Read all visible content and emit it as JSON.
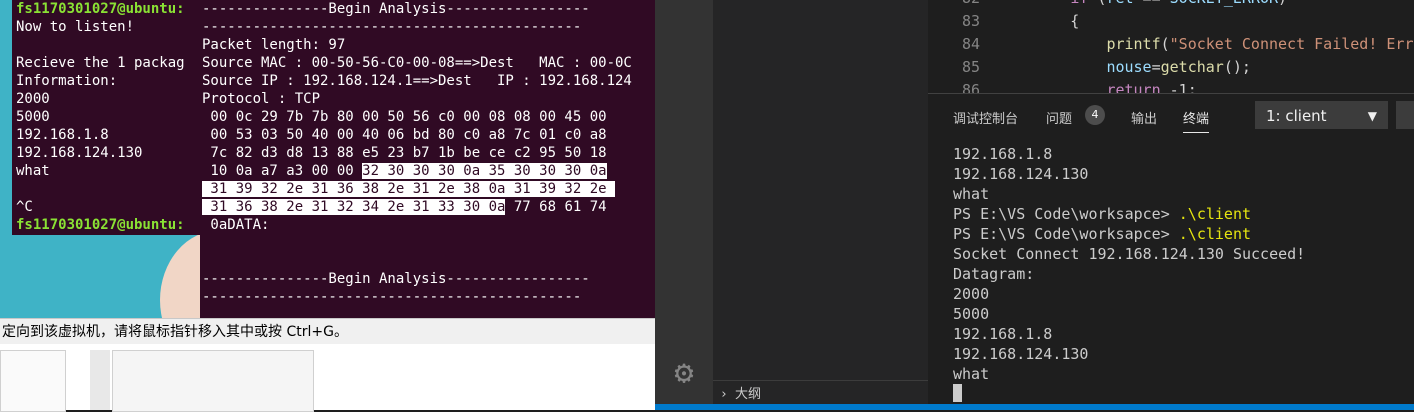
{
  "term1": {
    "lines": [
      {
        "type": "prompt",
        "text": "fs1170301027@ubuntu:"
      },
      {
        "type": "text",
        "text": "Now to listen!"
      },
      {
        "type": "text",
        "text": ""
      },
      {
        "type": "text",
        "text": "Recieve the 1 packag"
      },
      {
        "type": "text",
        "text": "Information:"
      },
      {
        "type": "text",
        "text": "2000"
      },
      {
        "type": "text",
        "text": "5000"
      },
      {
        "type": "text",
        "text": "192.168.1.8"
      },
      {
        "type": "text",
        "text": "192.168.124.130"
      },
      {
        "type": "text",
        "text": "what"
      },
      {
        "type": "text",
        "text": ""
      },
      {
        "type": "text",
        "text": "^C"
      },
      {
        "type": "prompt",
        "text": "fs1170301027@ubuntu:"
      }
    ]
  },
  "term2": {
    "lines": [
      {
        "segments": [
          {
            "t": "---------------Begin Analysis-----------------",
            "h": false
          }
        ]
      },
      {
        "segments": [
          {
            "t": "---------------------------------------------",
            "h": false
          }
        ]
      },
      {
        "segments": [
          {
            "t": "Packet length: 97",
            "h": false
          }
        ]
      },
      {
        "segments": [
          {
            "t": "Source MAC : 00-50-56-C0-00-08==>Dest   MAC : 00-0C",
            "h": false
          }
        ]
      },
      {
        "segments": [
          {
            "t": "Source IP : 192.168.124.1==>Dest   IP : 192.168.124",
            "h": false
          }
        ]
      },
      {
        "segments": [
          {
            "t": "Protocol : TCP",
            "h": false
          }
        ]
      },
      {
        "segments": [
          {
            "t": " 00 0c 29 7b 7b 80 00 50 56 c0 00 08 08 00 45 00",
            "h": false
          }
        ]
      },
      {
        "segments": [
          {
            "t": " 00 53 03 50 40 00 40 06 bd 80 c0 a8 7c 01 c0 a8",
            "h": false
          }
        ]
      },
      {
        "segments": [
          {
            "t": " 7c 82 d3 d8 13 88 e5 23 b7 1b be ce c2 95 50 18",
            "h": false
          }
        ]
      },
      {
        "segments": [
          {
            "t": " 10 0a a7 a3 00 00 ",
            "h": false
          },
          {
            "t": "32 30 30 30 0a 35 30 30 30 0a",
            "h": true
          }
        ]
      },
      {
        "segments": [
          {
            "t": " 31 39 32 2e 31 36 38 2e 31 2e 38 0a 31 39 32 2e ",
            "h": true
          }
        ]
      },
      {
        "segments": [
          {
            "t": " 31 36 38 2e 31 32 34 2e 31 33 30 0a",
            "h": true
          },
          {
            "t": " 77 68 61 74",
            "h": false
          }
        ]
      },
      {
        "segments": [
          {
            "t": " 0aDATA:",
            "h": false
          }
        ]
      },
      {
        "segments": [
          {
            "t": "",
            "h": false
          }
        ]
      },
      {
        "segments": [
          {
            "t": "",
            "h": false
          }
        ]
      },
      {
        "segments": [
          {
            "t": "---------------Begin Analysis-----------------",
            "h": false
          }
        ]
      },
      {
        "segments": [
          {
            "t": "---------------------------------------------",
            "h": false
          }
        ]
      }
    ]
  },
  "vm_hint": "定向到该虚拟机，请将鼠标指针移入其中或按 Ctrl+G。",
  "code": {
    "lines": [
      {
        "num": "82",
        "parts": [
          {
            "c": "pn",
            "t": "        "
          },
          {
            "c": "kw",
            "t": "if"
          },
          {
            "c": "pn",
            "t": " ("
          },
          {
            "c": "var",
            "t": "ret"
          },
          {
            "c": "pn",
            "t": " == "
          },
          {
            "c": "var",
            "t": "SOCKET_ERROR"
          },
          {
            "c": "pn",
            "t": ")"
          }
        ]
      },
      {
        "num": "83",
        "parts": [
          {
            "c": "pn",
            "t": "        {"
          }
        ]
      },
      {
        "num": "84",
        "parts": [
          {
            "c": "pn",
            "t": "            "
          },
          {
            "c": "fn",
            "t": "printf"
          },
          {
            "c": "pn",
            "t": "("
          },
          {
            "c": "str",
            "t": "\"Socket Connect Failed! Err"
          }
        ]
      },
      {
        "num": "85",
        "parts": [
          {
            "c": "pn",
            "t": "            "
          },
          {
            "c": "var",
            "t": "nouse"
          },
          {
            "c": "pn",
            "t": "="
          },
          {
            "c": "fn",
            "t": "getchar"
          },
          {
            "c": "pn",
            "t": "();"
          }
        ]
      },
      {
        "num": "86",
        "parts": [
          {
            "c": "pn",
            "t": "            "
          },
          {
            "c": "kw",
            "t": "return"
          },
          {
            "c": "pn",
            "t": " -1;"
          }
        ]
      }
    ]
  },
  "panel": {
    "tabs": [
      "调试控制台",
      "问题",
      "输出",
      "终端"
    ],
    "problems_count": "4",
    "active_tab": "终端",
    "terminal_select": "1: client"
  },
  "term3": {
    "lines": [
      {
        "t": "192.168.1.8",
        "cmd": ""
      },
      {
        "t": "192.168.124.130",
        "cmd": ""
      },
      {
        "t": "what",
        "cmd": ""
      },
      {
        "t": "PS E:\\VS Code\\worksapce> ",
        "cmd": ".\\client"
      },
      {
        "t": "PS E:\\VS Code\\worksapce> ",
        "cmd": ".\\client"
      },
      {
        "t": "Socket Connect 192.168.124.130 Succeed!",
        "cmd": ""
      },
      {
        "t": "Datagram:",
        "cmd": ""
      },
      {
        "t": "2000",
        "cmd": ""
      },
      {
        "t": "5000",
        "cmd": ""
      },
      {
        "t": "192.168.1.8",
        "cmd": ""
      },
      {
        "t": "192.168.124.130",
        "cmd": ""
      },
      {
        "t": "what",
        "cmd": ""
      }
    ]
  },
  "outline_label": "大纲",
  "icons": {
    "gear": "gear-icon",
    "chevron": "chevron-right-icon",
    "dropdown": "chevron-down-icon"
  },
  "colors": {
    "ubuntu_bg": "#300a24",
    "prompt_green": "#8ae234",
    "vscode_bg": "#1e1e1e",
    "status_blue": "#007acc"
  }
}
